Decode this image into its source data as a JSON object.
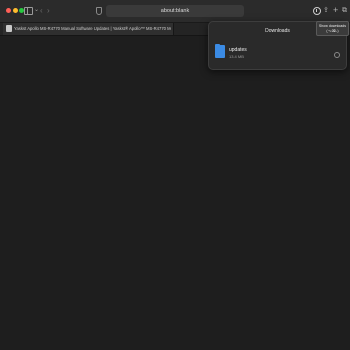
{
  "window": {
    "address": "about:blank"
  },
  "tabs": [
    {
      "title": "Yaskst Apollo MS-R4770 Manual Software Updates | Yaskst® Apollo™ MS-R4770 Melee Shears | Comet Customer Support"
    }
  ],
  "tooltip": {
    "line1": "Show downloads",
    "line2": "(⌥⌘L)"
  },
  "downloads": {
    "title": "Downloads",
    "items": [
      {
        "name": "updates",
        "size": "13.4 MB"
      }
    ]
  }
}
